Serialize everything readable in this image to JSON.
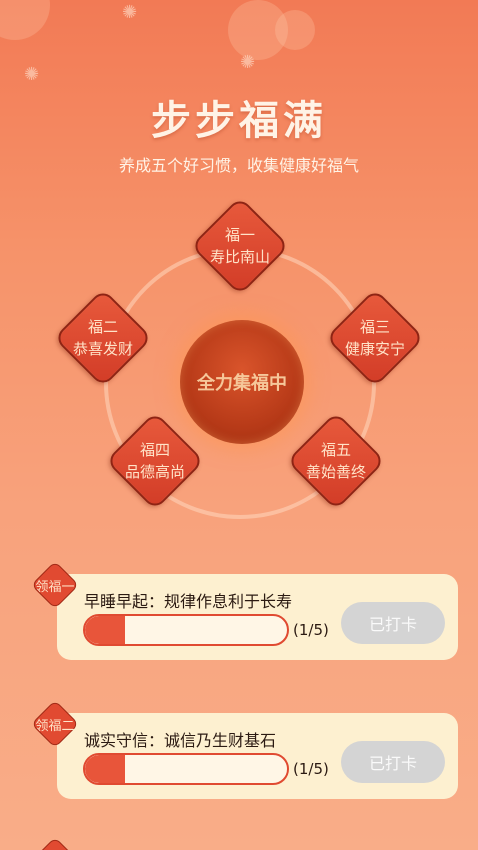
{
  "header": {
    "title": "步步福满",
    "subtitle": "养成五个好习惯，收集健康好福气"
  },
  "center": {
    "label": "全力集福中"
  },
  "fortunes": [
    {
      "name": "福一",
      "desc": "寿比南山"
    },
    {
      "name": "福二",
      "desc": "恭喜发财"
    },
    {
      "name": "福三",
      "desc": "健康安宁"
    },
    {
      "name": "福四",
      "desc": "品德高尚"
    },
    {
      "name": "福五",
      "desc": "善始善终"
    }
  ],
  "tasks": [
    {
      "tag": "领福一",
      "title": "早睡早起：规律作息利于长寿",
      "progress_text": "(1/5)",
      "progress_fraction": 0.2,
      "button_label": "已打卡"
    },
    {
      "tag": "领福二",
      "title": "诚实守信：诚信乃生财基石",
      "progress_text": "(1/5)",
      "progress_fraction": 0.2,
      "button_label": "已打卡"
    }
  ],
  "colors": {
    "accent": "#e8553a",
    "card_bg": "#fdf0d0",
    "button_disabled": "#d4d4d4"
  }
}
